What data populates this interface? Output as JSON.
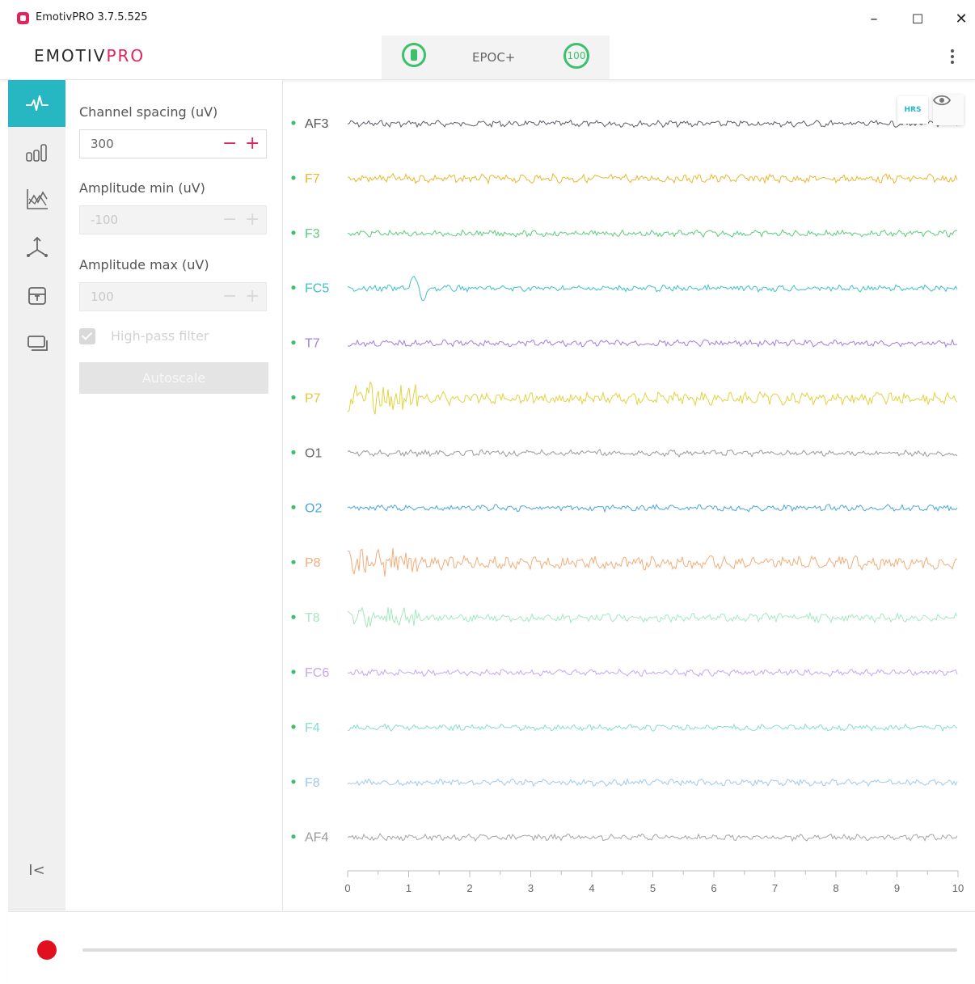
{
  "window": {
    "title": "EmotivPRO 3.7.5.525",
    "minimize": "–",
    "maximize": "☐",
    "close": "✕"
  },
  "header": {
    "brand_part1": "EMOTIV",
    "brand_part2": "PRO",
    "device_name": "EPOC+",
    "contact_quality": "100",
    "battery_icon": "battery-icon",
    "menu_icon": "more-vertical-icon"
  },
  "nav": {
    "items": [
      {
        "icon": "waveform-icon",
        "active": true
      },
      {
        "icon": "bar-chart-icon",
        "active": false
      },
      {
        "icon": "line-chart-icon",
        "active": false
      },
      {
        "icon": "axis-3d-icon",
        "active": false
      },
      {
        "icon": "archive-icon",
        "active": false
      },
      {
        "icon": "screens-icon",
        "active": false
      }
    ],
    "collapse_label": "I<"
  },
  "settings": {
    "channel_spacing": {
      "label": "Channel spacing (uV)",
      "value": "300"
    },
    "amplitude_min": {
      "label": "Amplitude min (uV)",
      "value": "-100"
    },
    "amplitude_max": {
      "label": "Amplitude max (uV)",
      "value": "100"
    },
    "stepper_minus": "−",
    "stepper_plus": "+",
    "high_pass_filter": {
      "label": "High-pass filter",
      "checked": true
    },
    "autoscale_label": "Autoscale"
  },
  "eeg": {
    "hrs_label": "HRS",
    "eye_icon": "eye-icon",
    "channels": [
      {
        "name": "AF3",
        "color": "#5a5d66"
      },
      {
        "name": "F7",
        "color": "#e8b830"
      },
      {
        "name": "F3",
        "color": "#5ccc7e"
      },
      {
        "name": "FC5",
        "color": "#3fc0c9"
      },
      {
        "name": "T7",
        "color": "#a07ee0"
      },
      {
        "name": "P7",
        "color": "#e2d23e"
      },
      {
        "name": "O1",
        "color": "#9a9a9a"
      },
      {
        "name": "O2",
        "color": "#4aa6dc"
      },
      {
        "name": "P8",
        "color": "#f3ad7a"
      },
      {
        "name": "T8",
        "color": "#a6e8c0"
      },
      {
        "name": "FC6",
        "color": "#c4a8ee"
      },
      {
        "name": "F4",
        "color": "#86dcd0"
      },
      {
        "name": "F8",
        "color": "#9ecaee"
      },
      {
        "name": "AF4",
        "color": "#a4a4a4"
      }
    ],
    "label_colors": {
      "AF3": "#555555",
      "F7": "#e8b830",
      "F3": "#5ccc7e",
      "FC5": "#3fc0c9",
      "T7": "#a07ee0",
      "P7": "#e2c83e",
      "O1": "#666666",
      "O2": "#4aa6dc",
      "P8": "#f3ad7a",
      "T8": "#a6e8c0",
      "FC6": "#c4a8ee",
      "F4": "#86dcd0",
      "F8": "#9ecaee",
      "AF4": "#9a9a9a"
    },
    "dot_color": "#3dc06c",
    "time_axis": {
      "ticks": [
        "0",
        "1",
        "2",
        "3",
        "4",
        "5",
        "6",
        "7",
        "8",
        "9",
        "10"
      ]
    }
  },
  "playback": {
    "record_button": "record-icon"
  }
}
